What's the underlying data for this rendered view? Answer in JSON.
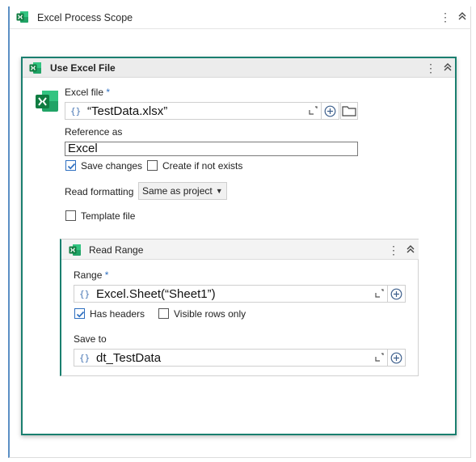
{
  "scope": {
    "title": "Excel Process Scope",
    "menu_glyph": "⋮",
    "icon": "excel-icon"
  },
  "use_excel_file": {
    "title": "Use Excel File",
    "menu_glyph": "⋮",
    "excel_file": {
      "label": "Excel file",
      "required_mark": "*",
      "brace": "{}",
      "value": "“TestData.xlsx”"
    },
    "reference_as": {
      "label": "Reference as",
      "value": "Excel"
    },
    "save_changes": {
      "label": "Save changes",
      "checked": true
    },
    "create_if_not_exists": {
      "label": "Create if not exists",
      "checked": false
    },
    "read_formatting": {
      "label": "Read formatting",
      "value": "Same as project",
      "arrow": "▼"
    },
    "template_file": {
      "label": "Template file",
      "checked": false
    }
  },
  "read_range": {
    "title": "Read Range",
    "menu_glyph": "⋮",
    "range": {
      "label": "Range",
      "required_mark": "*",
      "brace": "{}",
      "value": "Excel.Sheet(“Sheet1”)"
    },
    "has_headers": {
      "label": "Has headers",
      "checked": true
    },
    "visible_rows_only": {
      "label": "Visible rows only",
      "checked": false
    },
    "save_to": {
      "label": "Save to",
      "brace": "{}",
      "value": "dt_TestData"
    }
  },
  "colors": {
    "accent_teal": "#1a7f6f",
    "scope_border": "#5b8fc4",
    "excel_green": "#1d7044",
    "check_blue": "#2e6fc0"
  }
}
